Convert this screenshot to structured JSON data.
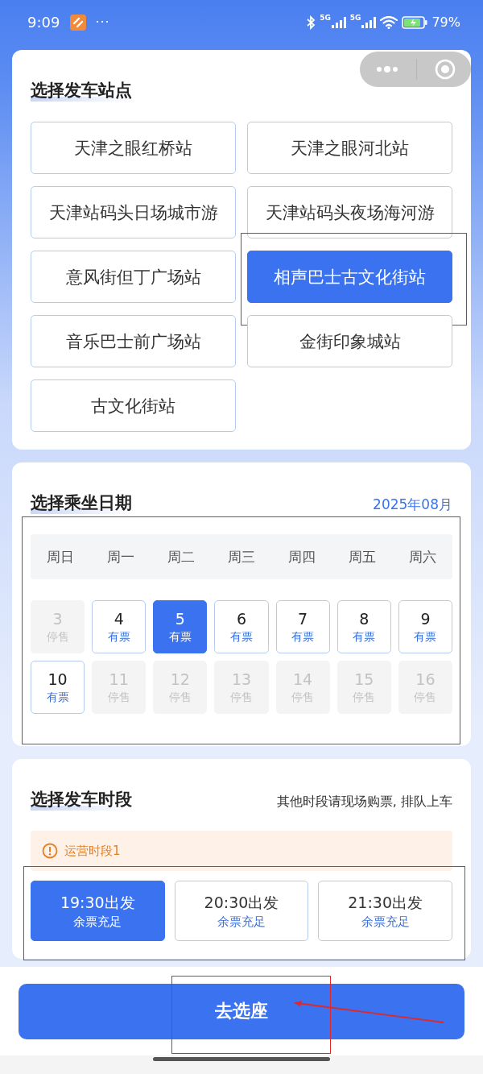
{
  "status_bar": {
    "time": "9:09",
    "more": "···",
    "network_1": "5G",
    "network_2": "5G",
    "battery": "79%"
  },
  "stations": {
    "title": "选择发车站点",
    "items": [
      {
        "name": "天津之眼红桥站",
        "selected": false
      },
      {
        "name": "天津之眼河北站",
        "selected": false
      },
      {
        "name": "天津站码头日场城市游",
        "selected": false
      },
      {
        "name": "天津站码头夜场海河游",
        "selected": false
      },
      {
        "name": "意风街但丁广场站",
        "selected": false
      },
      {
        "name": "相声巴士古文化街站",
        "selected": true
      },
      {
        "name": "音乐巴士前广场站",
        "selected": false
      },
      {
        "name": "金街印象城站",
        "selected": false
      },
      {
        "name": "古文化街站",
        "selected": false
      }
    ]
  },
  "dates": {
    "title": "选择乘坐日期",
    "month": "2025年08月",
    "weekdays": [
      "周日",
      "周一",
      "周二",
      "周三",
      "周四",
      "周五",
      "周六"
    ],
    "days": [
      {
        "day": "3",
        "status": "停售",
        "disabled": true,
        "selected": false
      },
      {
        "day": "4",
        "status": "有票",
        "disabled": false,
        "selected": false
      },
      {
        "day": "5",
        "status": "有票",
        "disabled": false,
        "selected": true
      },
      {
        "day": "6",
        "status": "有票",
        "disabled": false,
        "selected": false
      },
      {
        "day": "7",
        "status": "有票",
        "disabled": false,
        "selected": false
      },
      {
        "day": "8",
        "status": "有票",
        "disabled": false,
        "selected": false
      },
      {
        "day": "9",
        "status": "有票",
        "disabled": false,
        "selected": false
      },
      {
        "day": "10",
        "status": "有票",
        "disabled": false,
        "selected": false
      },
      {
        "day": "11",
        "status": "停售",
        "disabled": true,
        "selected": false
      },
      {
        "day": "12",
        "status": "停售",
        "disabled": true,
        "selected": false
      },
      {
        "day": "13",
        "status": "停售",
        "disabled": true,
        "selected": false
      },
      {
        "day": "14",
        "status": "停售",
        "disabled": true,
        "selected": false
      },
      {
        "day": "15",
        "status": "停售",
        "disabled": true,
        "selected": false
      },
      {
        "day": "16",
        "status": "停售",
        "disabled": true,
        "selected": false
      }
    ]
  },
  "times": {
    "title": "选择发车时段",
    "note": "其他时段请现场购票, 排队上车",
    "period": "运营时段1",
    "slots": [
      {
        "time": "19:30出发",
        "availability": "余票充足",
        "selected": true
      },
      {
        "time": "20:30出发",
        "availability": "余票充足",
        "selected": false
      },
      {
        "time": "21:30出发",
        "availability": "余票充足",
        "selected": false
      }
    ]
  },
  "action_button": "去选座"
}
